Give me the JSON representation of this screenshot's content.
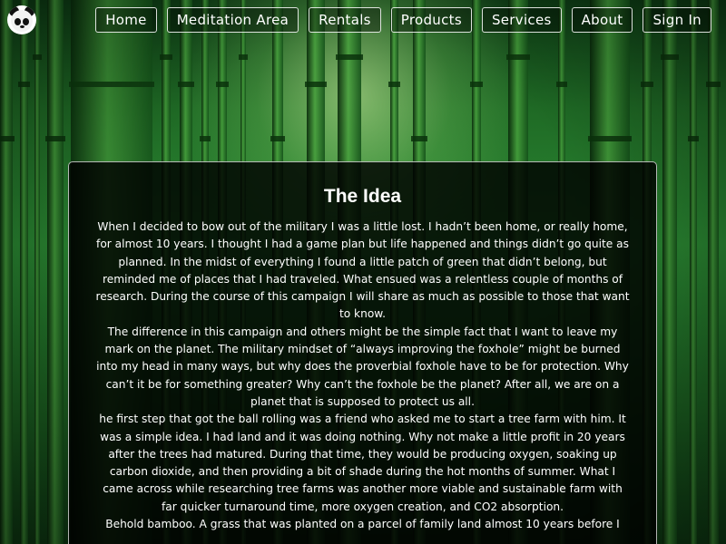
{
  "header": {
    "logo_icon": "panda-logo-icon",
    "nav": [
      {
        "label": "Home"
      },
      {
        "label": "Meditation Area"
      },
      {
        "label": "Rentals"
      },
      {
        "label": "Products"
      },
      {
        "label": "Services"
      },
      {
        "label": "About"
      },
      {
        "label": "Sign In"
      }
    ]
  },
  "article": {
    "title": "The Idea",
    "paragraphs": [
      "When I decided to bow out of the military I was a little lost. I hadn’t been home, or really home, for almost 10 years. I thought I had a game plan but life happened and things didn’t go quite as planned. In the midst of everything I found a little patch of green that didn’t belong, but reminded me of places that I had traveled. What ensued was a relentless couple of months of research. During the course of this campaign I will share as much as possible to those that want to know.",
      "The difference in this campaign and others might be the simple fact that I want to leave my mark on the planet. The military mindset of “always improving the foxhole” might be burned into my head in many ways, but why does the proverbial foxhole have to be for protection. Why can’t it be for something greater? Why can’t the foxhole be the planet? After all, we are on a planet that is supposed to protect us all.",
      "he first step that got the ball rolling was a friend who asked me to start a tree farm with him. It was a simple idea. I had land and it was doing nothing. Why not make a little profit in 20 years after the trees had matured. During that time, they would be producing oxygen, soaking up carbon dioxide, and then providing a bit of shade during the hot months of summer. What I came across while researching tree farms was another more viable and sustainable farm with far quicker turnaround time, more oxygen creation, and CO2 absorption.",
      "Behold bamboo. A grass that was planted on a parcel of family land almost 10 years before I"
    ]
  },
  "colors": {
    "card_background": "#000000",
    "text": "#ffffff",
    "forest_green": "#2b8a33"
  }
}
